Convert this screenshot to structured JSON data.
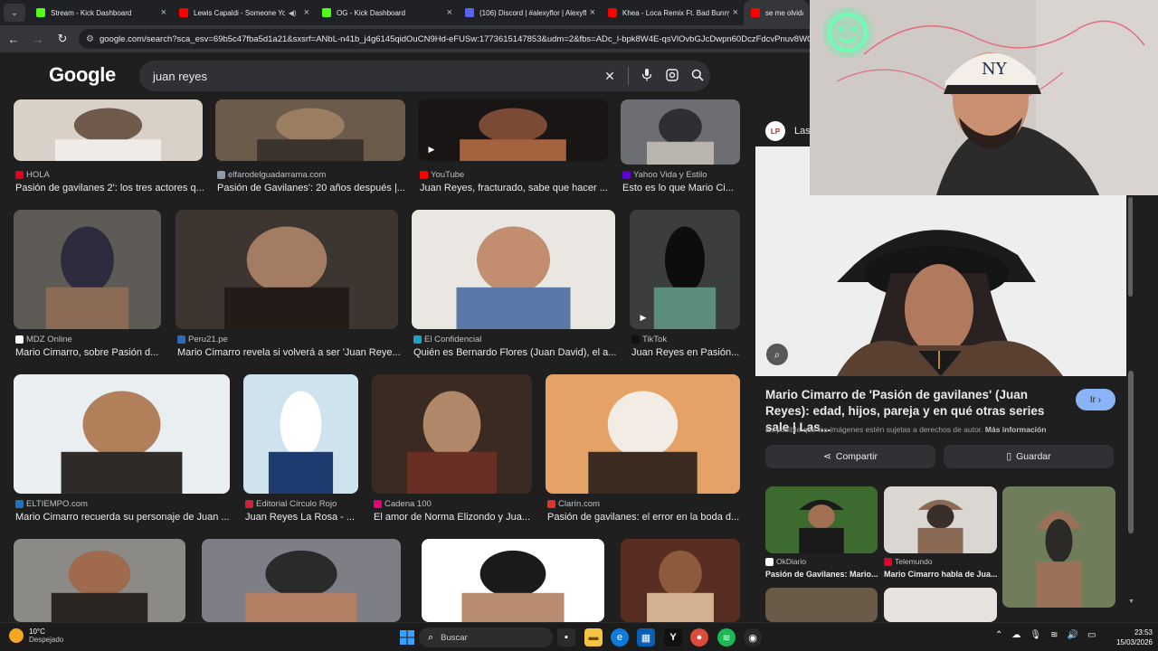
{
  "browser": {
    "tabs": [
      {
        "title": "Stream - Kick Dashboard",
        "fav_color": "#53fc18",
        "fav_letter": "K",
        "active": false
      },
      {
        "title": "Lewis Capaldi - Someone You Loved",
        "fav_color": "#ff0000",
        "fav_letter": "▶",
        "active": false,
        "audio": true
      },
      {
        "title": "OG - Kick Dashboard",
        "fav_color": "#53fc18",
        "fav_letter": "K",
        "active": false
      },
      {
        "title": "(106) Discord | #alexyflor | Alexyflor",
        "fav_color": "#5865f2",
        "fav_letter": "D",
        "active": false
      },
      {
        "title": "Khea - Loca Remix Ft. Bad Bunny",
        "fav_color": "#ff0000",
        "fav_letter": "▶",
        "active": false
      },
      {
        "title": "se me olvida fei...",
        "fav_color": "#ff0000",
        "fav_letter": "▶",
        "active": true
      }
    ],
    "url": "google.com/search?sca_esv=69b5c47fba5d1a21&sxsrf=ANbL-n41b_j4g6145qidOuCN9Hd-eFUSw:1773615147853&udm=2&fbs=ADc_l-bpk8W4E-qsVlOvbGJcDwpn60DczFdcvPnuv8WQohHLTa"
  },
  "google": {
    "logo": "Google",
    "query": "juan reyes"
  },
  "results": [
    {
      "source": "HOLA",
      "caption": "Pasión de gavilanes 2': los tres actores q...",
      "fav": "#e3001b"
    },
    {
      "source": "elfarodelguadarrama.com",
      "caption": "Pasión de Gavilanes': 20 años después |...",
      "fav": "#8f9ba8"
    },
    {
      "source": "YouTube",
      "caption": "Juan Reyes, fracturado, sabe que hacer ...",
      "fav": "#ff0000",
      "video": true
    },
    {
      "source": "Yahoo Vida y Estilo",
      "caption": "Esto es lo que Mario Ci...",
      "fav": "#6001d2"
    },
    {
      "source": "MDZ Online",
      "caption": "Mario Cimarro, sobre Pasión d...",
      "fav": "#ffffff"
    },
    {
      "source": "Peru21.pe",
      "caption": "Mario Cimarro revela si volverá a ser 'Juan Reye...",
      "fav": "#2d6cb5"
    },
    {
      "source": "El Confidencial",
      "caption": "Quién es Bernardo Flores (Juan David), el a...",
      "fav": "#1aa3c7"
    },
    {
      "source": "TikTok",
      "caption": "Juan Reyes en Pasión...",
      "fav": "#111111",
      "video": true
    },
    {
      "source": "ELTIEMPO.com",
      "caption": "Mario Cimarro recuerda su personaje de Juan ...",
      "fav": "#1c73c4"
    },
    {
      "source": "Editorial Círculo Rojo",
      "caption": "Juan Reyes La Rosa - ...",
      "fav": "#d0223b"
    },
    {
      "source": "Cadena 100",
      "caption": "El amor de Norma Elizondo y Jua...",
      "fav": "#e5007d"
    },
    {
      "source": "Clarín.com",
      "caption": "Pasión de gavilanes: el error en la boda d...",
      "fav": "#e4322b"
    },
    {
      "source": "",
      "caption": "",
      "fav": ""
    },
    {
      "source": "",
      "caption": "",
      "fav": ""
    },
    {
      "source": "",
      "caption": "",
      "fav": ""
    },
    {
      "source": "",
      "caption": "",
      "fav": ""
    }
  ],
  "panel": {
    "site": "Las",
    "logo_text": "LP",
    "title": "Mario Cimarro de 'Pasión de gavilanes' (Juan Reyes): edad, hijos, pareja y en qué otras series sale | Las...",
    "go_label": "Ir",
    "rights_text": "Es posible que las imágenes estén sujetas a derechos de autor.",
    "rights_link": "Más información",
    "share_label": "Compartir",
    "save_label": "Guardar",
    "related": [
      {
        "source": "OkDiario",
        "caption": "Pasión de Gavilanes: Mario...",
        "fav": "#ffffff"
      },
      {
        "source": "Telemundo",
        "caption": "Mario Cimarro habla de Jua...",
        "fav": "#e4002b"
      },
      {
        "source": "",
        "caption": "",
        "fav": ""
      }
    ]
  },
  "taskbar": {
    "temp": "10°C",
    "weather": "Despejado",
    "search_placeholder": "Buscar",
    "time": "23:53",
    "date": "15/03/2026"
  }
}
